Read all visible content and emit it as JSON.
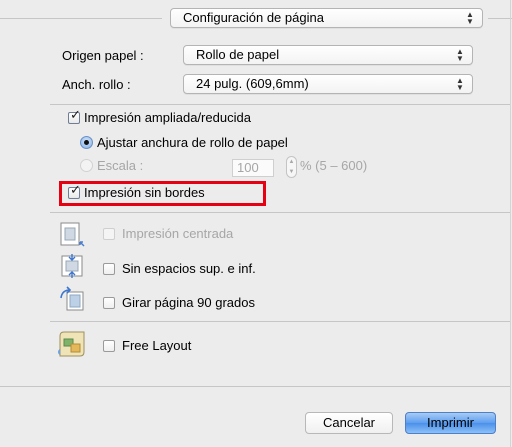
{
  "preset_popup": {
    "value": "Configuración de página"
  },
  "paper_source": {
    "label": "Origen papel :",
    "value": "Rollo de papel"
  },
  "roll_width": {
    "label": "Anch. rollo :",
    "value": "24 pulg. (609,6mm)"
  },
  "enlarged_reduced": {
    "label": "Impresión ampliada/reducida",
    "checked": true
  },
  "fit_roll_width": {
    "label": "Ajustar anchura de rollo de papel",
    "selected": true
  },
  "scale": {
    "label": "Escala :",
    "value": "100",
    "range": "% (5 – 600)",
    "enabled": false
  },
  "borderless": {
    "label": "Impresión sin bordes",
    "checked": true,
    "highlight_color": "#e50012"
  },
  "print_centered": {
    "label": "Impresión centrada",
    "checked": false,
    "enabled": false,
    "icon": "print-centered-icon"
  },
  "no_top_bottom_space": {
    "label": "Sin espacios sup. e inf.",
    "checked": false,
    "icon": "no-space-icon"
  },
  "rotate_90": {
    "label": "Girar página 90 grados",
    "checked": false,
    "icon": "rotate-page-icon"
  },
  "free_layout": {
    "label": "Free Layout",
    "checked": false,
    "icon": "free-layout-icon"
  },
  "buttons": {
    "cancel": "Cancelar",
    "print": "Imprimir"
  },
  "colors": {
    "accent": "#5d9ef0",
    "highlight": "#e50012",
    "background": "#ececec"
  }
}
